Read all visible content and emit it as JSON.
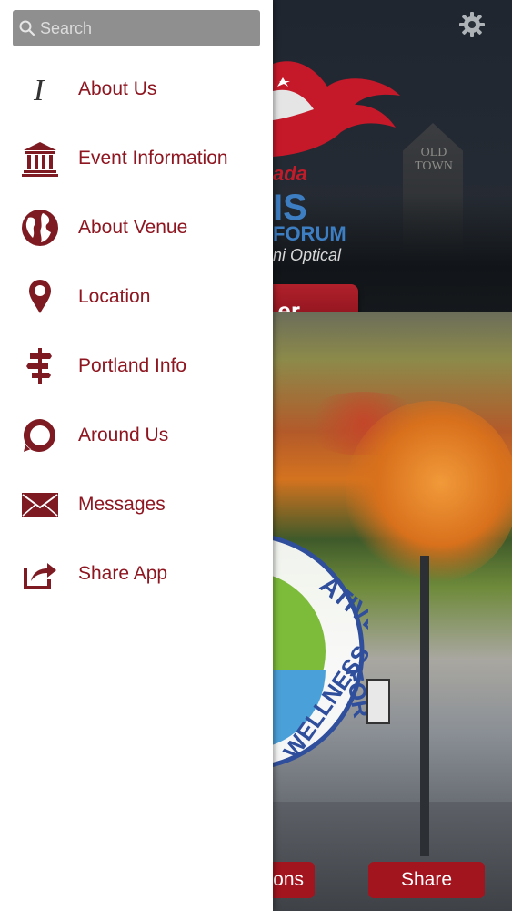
{
  "search": {
    "placeholder": "Search"
  },
  "menu": {
    "items": [
      {
        "label": "About Us",
        "icon": "info-cursor-icon"
      },
      {
        "label": "Event Information",
        "icon": "museum-icon"
      },
      {
        "label": "About Venue",
        "icon": "globe-icon"
      },
      {
        "label": "Location",
        "icon": "map-pin-icon"
      },
      {
        "label": "Portland Info",
        "icon": "signpost-icon"
      },
      {
        "label": "Around Us",
        "icon": "speech-bubble-icon"
      },
      {
        "label": "Messages",
        "icon": "envelope-icon"
      },
      {
        "label": "Share App",
        "icon": "share-icon"
      }
    ]
  },
  "background": {
    "logo": {
      "line1": "ada",
      "line2": "IS",
      "line3": "FORUM",
      "line4": "ni Optical"
    },
    "tower_text": "OLD TOWN",
    "register_button": "er",
    "badge_text": "ATIVE FOR · WELLNESS",
    "bottom_buttons": {
      "left": "ons",
      "share": "Share"
    }
  },
  "colors": {
    "accent": "#8e1620",
    "search_bg": "#8f8f8f",
    "button_red": "#a2151f"
  }
}
